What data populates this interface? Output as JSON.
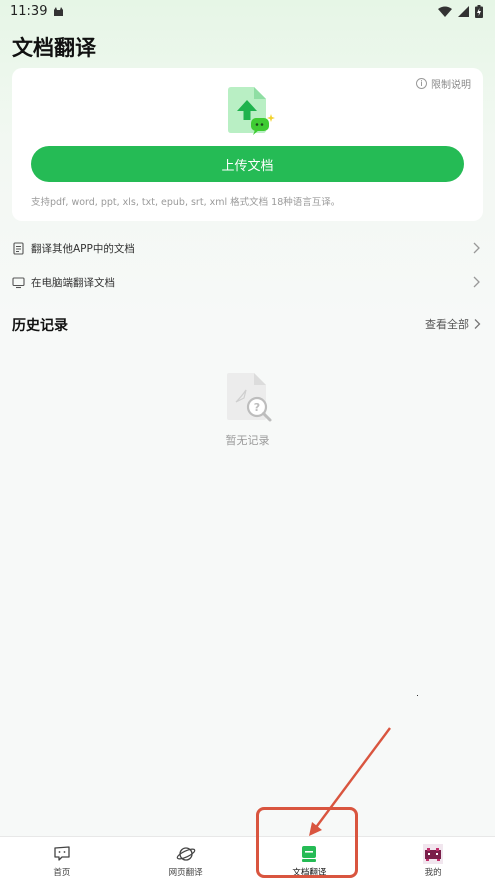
{
  "status_bar": {
    "time": "11:39"
  },
  "header": {
    "title": "文档翻译"
  },
  "upload_card": {
    "limit_label": "限制说明",
    "upload_button": "上传文档",
    "support_text": "支持pdf, word, ppt, xls, txt, epub, srt, xml 格式文档 18种语言互译。"
  },
  "links": [
    {
      "label": "翻译其他APP中的文档",
      "icon": "document-icon"
    },
    {
      "label": "在电脑端翻译文档",
      "icon": "monitor-icon"
    }
  ],
  "history": {
    "title": "历史记录",
    "view_all": "查看全部",
    "empty_text": "暂无记录"
  },
  "tab_bar": {
    "tabs": [
      {
        "label": "首页",
        "icon": "home-icon",
        "active": false
      },
      {
        "label": "网页翻译",
        "icon": "planet-icon",
        "active": false
      },
      {
        "label": "文档翻译",
        "icon": "document-translate-icon",
        "active": true
      },
      {
        "label": "我的",
        "icon": "avatar-icon",
        "active": false
      }
    ]
  },
  "colors": {
    "accent": "#25bb55",
    "annotation": "#d9553f"
  }
}
